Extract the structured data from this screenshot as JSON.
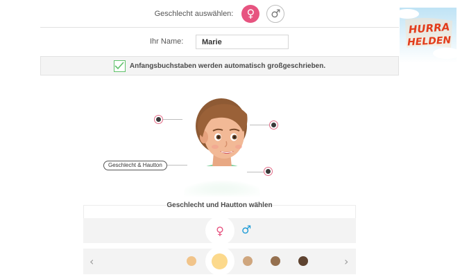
{
  "gender_select": {
    "label": "Geschlecht auswählen:",
    "female_symbol": "♀",
    "male_symbol": "♂",
    "selected": "female"
  },
  "logo": {
    "line1": "HURRA",
    "line2": "HELDEN"
  },
  "name": {
    "label": "Ihr Name:",
    "value": "Marie"
  },
  "capitalize": {
    "checked": true,
    "text": "Anfangsbuchstaben werden automatisch großgeschrieben."
  },
  "avatar": {
    "callout_label": "Geschlecht & Hautton"
  },
  "panel": {
    "title": "Geschlecht und Hautton wählen",
    "female_symbol": "♀",
    "male_symbol": "♂",
    "prev_arrow": "‹",
    "next_arrow": "›",
    "skin_tones": [
      "#f1c48a",
      "#fcd98c",
      "#cfa67e",
      "#95704f",
      "#5e4330"
    ],
    "selected_skin_index": 1
  },
  "colors": {
    "accent_pink": "#e75480",
    "accent_blue": "#1a9ad6",
    "check_green": "#5fc16a",
    "logo_red": "#e23c1b"
  }
}
